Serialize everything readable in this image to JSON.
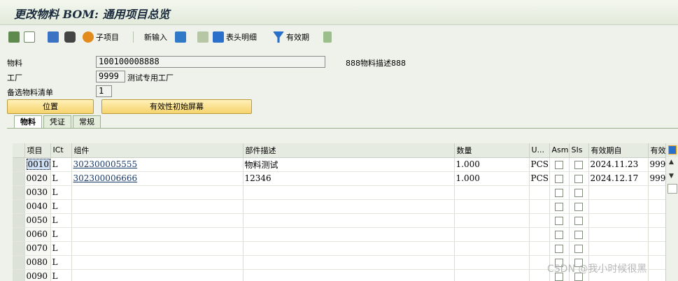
{
  "window": {
    "title": "更改物料 BOM: 通用项目总览"
  },
  "toolbar": {
    "subitem_label": "子项目",
    "new_entry_label": "新输入",
    "header_detail_label": "表头明细",
    "validity_label": "有效期"
  },
  "header": {
    "material_label": "物料",
    "material_value": "100100008888",
    "material_desc": "888物料描述888",
    "plant_label": "工厂",
    "plant_value": "9999",
    "plant_desc": "测试专用工厂",
    "alt_bom_label": "备选物料清单",
    "alt_bom_value": "1",
    "position_button": "位置",
    "validity_button": "有效性初始屏幕"
  },
  "tabs": [
    "物料",
    "凭证",
    "常规"
  ],
  "grid": {
    "columns": [
      "项目",
      "ICt",
      "组件",
      "部件描述",
      "数量",
      "U...",
      "Asm",
      "SIs",
      "有效期自",
      "有效"
    ],
    "rows": [
      {
        "item": "0010",
        "ict": "L",
        "component": "302300005555",
        "desc": "物料测试",
        "qty": "1.000",
        "unit": "PCS",
        "from": "2024.11.23",
        "to": "999"
      },
      {
        "item": "0020",
        "ict": "L",
        "component": "302300006666",
        "desc": "12346",
        "qty": "1.000",
        "unit": "PCS",
        "from": "2024.12.17",
        "to": "999"
      },
      {
        "item": "0030",
        "ict": "L"
      },
      {
        "item": "0040",
        "ict": "L"
      },
      {
        "item": "0050",
        "ict": "L"
      },
      {
        "item": "0060",
        "ict": "L"
      },
      {
        "item": "0070",
        "ict": "L"
      },
      {
        "item": "0080",
        "ict": "L"
      },
      {
        "item": "0090",
        "ict": "L"
      }
    ]
  },
  "watermark": "CSDN @我小时候很黑"
}
